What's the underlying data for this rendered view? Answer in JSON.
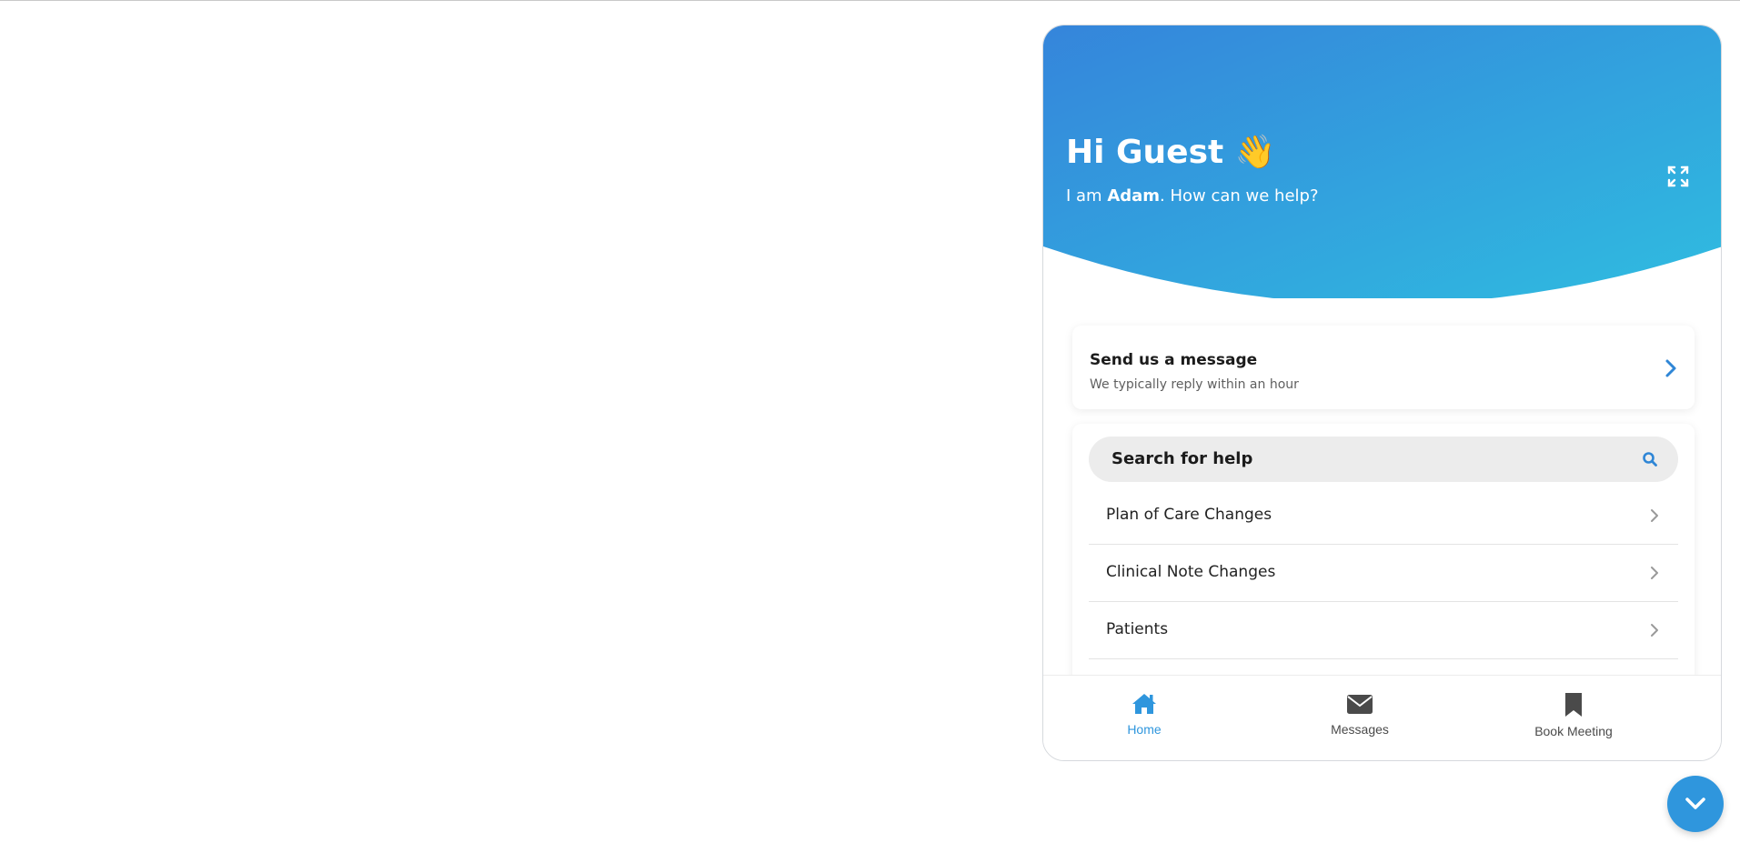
{
  "widget": {
    "header": {
      "greeting": "Hi Guest",
      "wave_emoji": "👋",
      "subtitle_prefix": "I am ",
      "agent_name": "Adam",
      "subtitle_suffix": ". How can we help?",
      "expand_icon": "expand-icon",
      "gradient_start": "#3585db",
      "gradient_end": "#2fbde0"
    },
    "message_card": {
      "title": "Send us a message",
      "subtitle": "We typically reply within an hour",
      "chevron_icon": "chevron-right-icon",
      "chevron_color": "#2f86d6"
    },
    "help": {
      "search_label": "Search for help",
      "search_icon": "search-icon",
      "items": [
        {
          "label": "Plan of Care Changes"
        },
        {
          "label": "Clinical Note Changes"
        },
        {
          "label": "Patients"
        }
      ]
    },
    "bottom_nav": {
      "items": [
        {
          "label": "Home",
          "icon": "home-icon",
          "active": true
        },
        {
          "label": "Messages",
          "icon": "envelope-icon",
          "active": false
        },
        {
          "label": "Book Meeting",
          "icon": "bookmark-icon",
          "active": false
        }
      ],
      "active_color": "#2f96dd"
    }
  },
  "launcher": {
    "icon": "chevron-down-icon",
    "color": "#2f96dd"
  }
}
